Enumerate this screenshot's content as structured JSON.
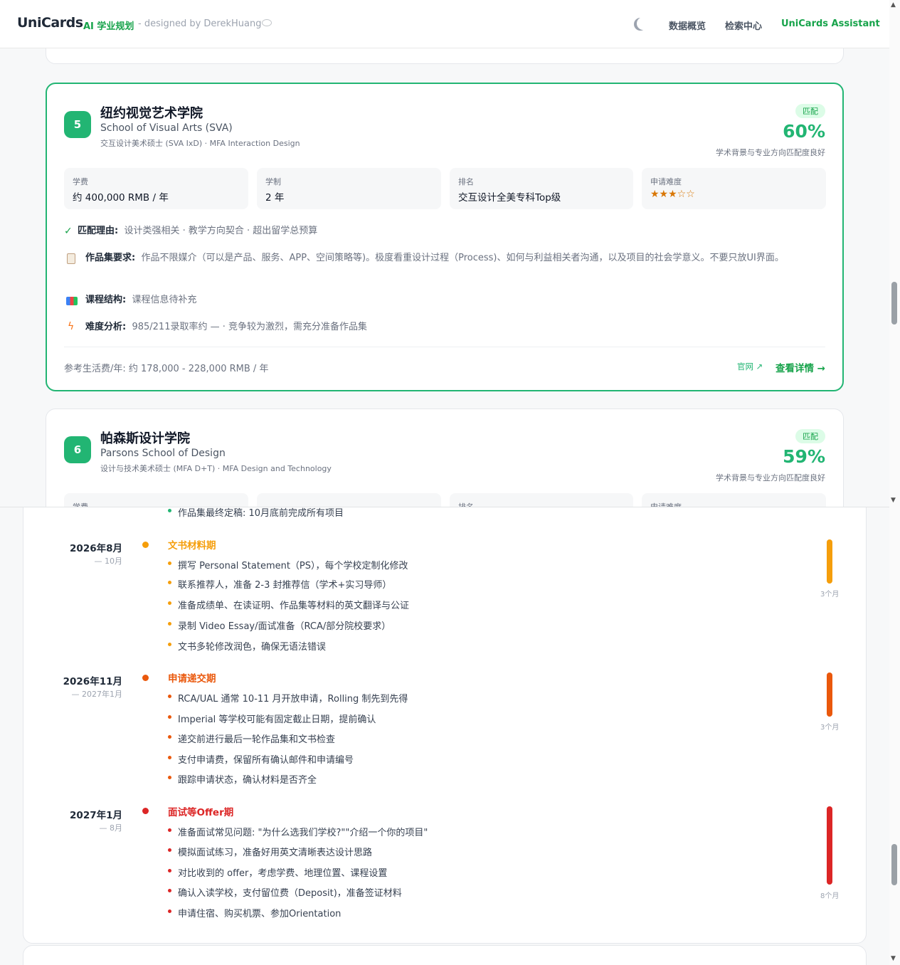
{
  "header": {
    "logo": "UniCards",
    "tag": "AI 学业规划",
    "byline": "- designed by DerekHuang",
    "nav": [
      "数据概览",
      "检索中心",
      "UniCards Assistant"
    ]
  },
  "cards": [
    {
      "rank": "5",
      "name_cn": "纽约视觉艺术学院",
      "name_en": "School of Visual Arts (SVA)",
      "program": "交互设计美术硕士 (SVA IxD) · MFA Interaction Design",
      "badge": "匹配",
      "pct": "60%",
      "pct_note": "学术背景与专业方向匹配度良好",
      "info": [
        {
          "label": "学费",
          "value": "约 400,000 RMB / 年"
        },
        {
          "label": "学制",
          "value": "2 年"
        },
        {
          "label": "排名",
          "value": "交互设计全美专科Top级"
        },
        {
          "label": "申请难度",
          "value": "★★★☆☆"
        }
      ],
      "reason_label": "匹配理由:",
      "reason": "设计类强相关 · 教学方向契合 · 超出留学总预算",
      "portfolio_label": "作品集要求:",
      "portfolio": "作品不限媒介（可以是产品、服务、APP、空间策略等)。极度看重设计过程（Process)、如何与利益相关者沟通，以及项目的社会学意义。不要只放UI界面。",
      "course_label": "课程结构:",
      "course": "课程信息待补充",
      "difficulty_label": "难度分析:",
      "difficulty": "985/211录取率约 — · 竞争较为激烈，需充分准备作品集",
      "living": "参考生活费/年: 约 178,000 - 228,000 RMB / 年",
      "official": "官网",
      "detail": "查看详情 →"
    },
    {
      "rank": "6",
      "name_cn": "帕森斯设计学院",
      "name_en": "Parsons School of Design",
      "program": "设计与技术美术硕士 (MFA D+T) · MFA Design and Technology",
      "badge": "匹配",
      "pct": "59%",
      "pct_note": "学术背景与专业方向匹配度良好",
      "info": [
        {
          "label": "学费"
        },
        {
          "label": ""
        },
        {
          "label": "排名"
        },
        {
          "label": "申请难度"
        }
      ]
    }
  ],
  "timeline": {
    "partial_item": "作品集最终定稿: 10月底前完成所有项目",
    "phases": [
      {
        "date": "2026年8月",
        "sub": "— 10月",
        "title": "文书材料期",
        "color": "#f59e0b",
        "duration": "3个月",
        "items": [
          "撰写 Personal Statement（PS），每个学校定制化修改",
          "联系推荐人，准备 2-3 封推荐信（学术+实习导师）",
          "准备成绩单、在读证明、作品集等材料的英文翻译与公证",
          "录制 Video Essay/面试准备（RCA/部分院校要求）",
          "文书多轮修改润色，确保无语法错误"
        ]
      },
      {
        "date": "2026年11月",
        "sub": "— 2027年1月",
        "title": "申请递交期",
        "color": "#ea580c",
        "duration": "3个月",
        "items": [
          "RCA/UAL 通常 10-11 月开放申请，Rolling 制先到先得",
          "Imperial 等学校可能有固定截止日期，提前确认",
          "递交前进行最后一轮作品集和文书检查",
          "支付申请费，保留所有确认邮件和申请编号",
          "跟踪申请状态，确认材料是否齐全"
        ]
      },
      {
        "date": "2027年1月",
        "sub": "— 8月",
        "title": "面试等Offer期",
        "color": "#dc2626",
        "duration": "8个月",
        "items": [
          "准备面试常见问题: \"为什么选我们学校?\"\"介绍一个你的项目\"",
          "模拟面试练习，准备好用英文清晰表达设计思路",
          "对比收到的 offer，考虑学费、地理位置、课程设置",
          "确认入读学校，支付留位费（Deposit)，准备签证材料",
          "申请住宿、购买机票、参加Orientation"
        ]
      }
    ]
  }
}
